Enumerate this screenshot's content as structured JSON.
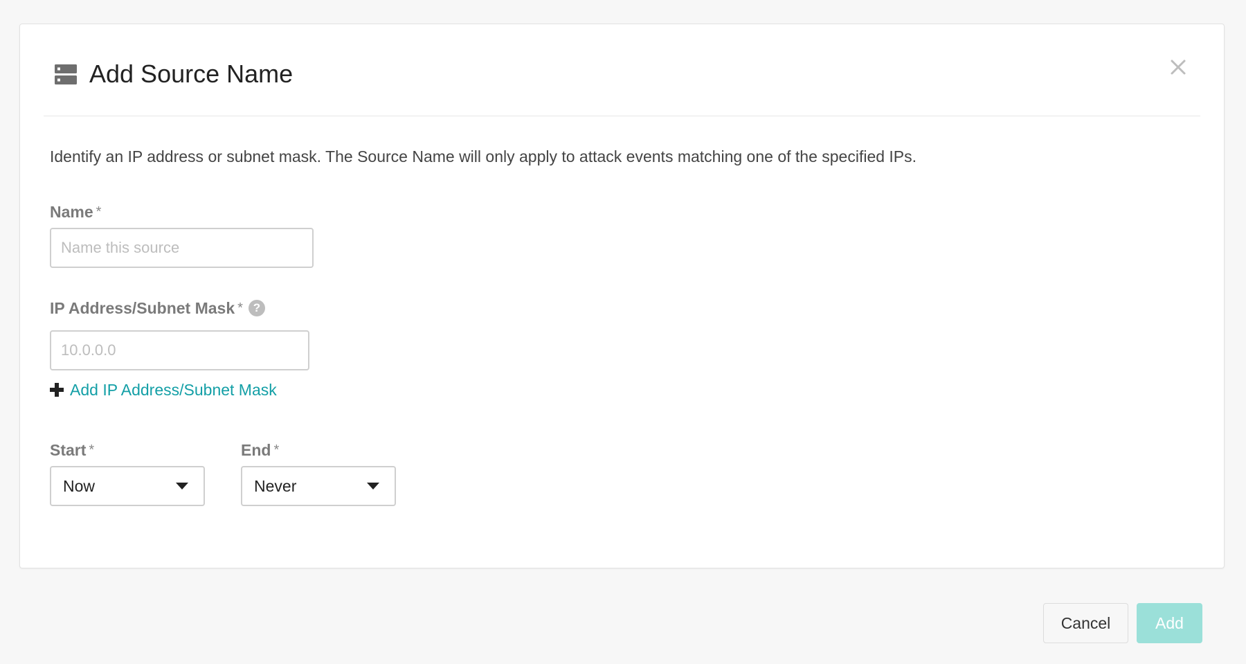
{
  "dialog": {
    "title": "Add Source Name",
    "header_icon": "server-icon",
    "close_icon": "close-icon",
    "description": "Identify an IP address or subnet mask. The Source Name will only apply to attack events matching one of the specified IPs."
  },
  "form": {
    "name": {
      "label": "Name",
      "required_mark": "*",
      "value": "",
      "placeholder": "Name this source"
    },
    "ip": {
      "label": "IP Address/Subnet Mask",
      "required_mark": "*",
      "help_icon": "help-icon",
      "help_glyph": "?",
      "value": "",
      "placeholder": "10.0.0.0"
    },
    "add_ip": {
      "icon": "plus-icon",
      "label": "Add IP Address/Subnet Mask"
    },
    "start": {
      "label": "Start",
      "required_mark": "*",
      "selected": "Now"
    },
    "end": {
      "label": "End",
      "required_mark": "*",
      "selected": "Never"
    }
  },
  "footer": {
    "cancel_label": "Cancel",
    "add_label": "Add"
  },
  "colors": {
    "link": "#139fa6",
    "primary_disabled": "#9be0d9",
    "background": "#f7f7f7"
  }
}
